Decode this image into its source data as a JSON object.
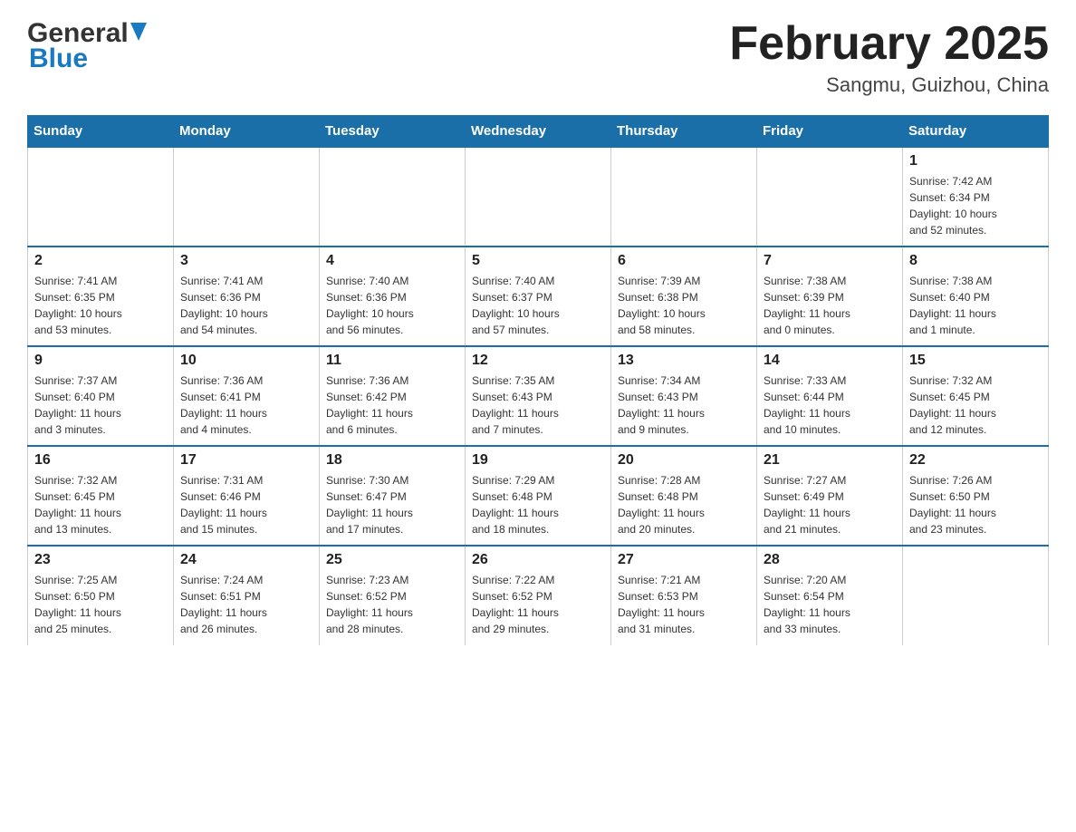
{
  "header": {
    "logo_general": "General",
    "logo_blue": "Blue",
    "title": "February 2025",
    "subtitle": "Sangmu, Guizhou, China"
  },
  "weekdays": [
    "Sunday",
    "Monday",
    "Tuesday",
    "Wednesday",
    "Thursday",
    "Friday",
    "Saturday"
  ],
  "weeks": [
    [
      {
        "day": "",
        "info": ""
      },
      {
        "day": "",
        "info": ""
      },
      {
        "day": "",
        "info": ""
      },
      {
        "day": "",
        "info": ""
      },
      {
        "day": "",
        "info": ""
      },
      {
        "day": "",
        "info": ""
      },
      {
        "day": "1",
        "info": "Sunrise: 7:42 AM\nSunset: 6:34 PM\nDaylight: 10 hours\nand 52 minutes."
      }
    ],
    [
      {
        "day": "2",
        "info": "Sunrise: 7:41 AM\nSunset: 6:35 PM\nDaylight: 10 hours\nand 53 minutes."
      },
      {
        "day": "3",
        "info": "Sunrise: 7:41 AM\nSunset: 6:36 PM\nDaylight: 10 hours\nand 54 minutes."
      },
      {
        "day": "4",
        "info": "Sunrise: 7:40 AM\nSunset: 6:36 PM\nDaylight: 10 hours\nand 56 minutes."
      },
      {
        "day": "5",
        "info": "Sunrise: 7:40 AM\nSunset: 6:37 PM\nDaylight: 10 hours\nand 57 minutes."
      },
      {
        "day": "6",
        "info": "Sunrise: 7:39 AM\nSunset: 6:38 PM\nDaylight: 10 hours\nand 58 minutes."
      },
      {
        "day": "7",
        "info": "Sunrise: 7:38 AM\nSunset: 6:39 PM\nDaylight: 11 hours\nand 0 minutes."
      },
      {
        "day": "8",
        "info": "Sunrise: 7:38 AM\nSunset: 6:40 PM\nDaylight: 11 hours\nand 1 minute."
      }
    ],
    [
      {
        "day": "9",
        "info": "Sunrise: 7:37 AM\nSunset: 6:40 PM\nDaylight: 11 hours\nand 3 minutes."
      },
      {
        "day": "10",
        "info": "Sunrise: 7:36 AM\nSunset: 6:41 PM\nDaylight: 11 hours\nand 4 minutes."
      },
      {
        "day": "11",
        "info": "Sunrise: 7:36 AM\nSunset: 6:42 PM\nDaylight: 11 hours\nand 6 minutes."
      },
      {
        "day": "12",
        "info": "Sunrise: 7:35 AM\nSunset: 6:43 PM\nDaylight: 11 hours\nand 7 minutes."
      },
      {
        "day": "13",
        "info": "Sunrise: 7:34 AM\nSunset: 6:43 PM\nDaylight: 11 hours\nand 9 minutes."
      },
      {
        "day": "14",
        "info": "Sunrise: 7:33 AM\nSunset: 6:44 PM\nDaylight: 11 hours\nand 10 minutes."
      },
      {
        "day": "15",
        "info": "Sunrise: 7:32 AM\nSunset: 6:45 PM\nDaylight: 11 hours\nand 12 minutes."
      }
    ],
    [
      {
        "day": "16",
        "info": "Sunrise: 7:32 AM\nSunset: 6:45 PM\nDaylight: 11 hours\nand 13 minutes."
      },
      {
        "day": "17",
        "info": "Sunrise: 7:31 AM\nSunset: 6:46 PM\nDaylight: 11 hours\nand 15 minutes."
      },
      {
        "day": "18",
        "info": "Sunrise: 7:30 AM\nSunset: 6:47 PM\nDaylight: 11 hours\nand 17 minutes."
      },
      {
        "day": "19",
        "info": "Sunrise: 7:29 AM\nSunset: 6:48 PM\nDaylight: 11 hours\nand 18 minutes."
      },
      {
        "day": "20",
        "info": "Sunrise: 7:28 AM\nSunset: 6:48 PM\nDaylight: 11 hours\nand 20 minutes."
      },
      {
        "day": "21",
        "info": "Sunrise: 7:27 AM\nSunset: 6:49 PM\nDaylight: 11 hours\nand 21 minutes."
      },
      {
        "day": "22",
        "info": "Sunrise: 7:26 AM\nSunset: 6:50 PM\nDaylight: 11 hours\nand 23 minutes."
      }
    ],
    [
      {
        "day": "23",
        "info": "Sunrise: 7:25 AM\nSunset: 6:50 PM\nDaylight: 11 hours\nand 25 minutes."
      },
      {
        "day": "24",
        "info": "Sunrise: 7:24 AM\nSunset: 6:51 PM\nDaylight: 11 hours\nand 26 minutes."
      },
      {
        "day": "25",
        "info": "Sunrise: 7:23 AM\nSunset: 6:52 PM\nDaylight: 11 hours\nand 28 minutes."
      },
      {
        "day": "26",
        "info": "Sunrise: 7:22 AM\nSunset: 6:52 PM\nDaylight: 11 hours\nand 29 minutes."
      },
      {
        "day": "27",
        "info": "Sunrise: 7:21 AM\nSunset: 6:53 PM\nDaylight: 11 hours\nand 31 minutes."
      },
      {
        "day": "28",
        "info": "Sunrise: 7:20 AM\nSunset: 6:54 PM\nDaylight: 11 hours\nand 33 minutes."
      },
      {
        "day": "",
        "info": ""
      }
    ]
  ]
}
